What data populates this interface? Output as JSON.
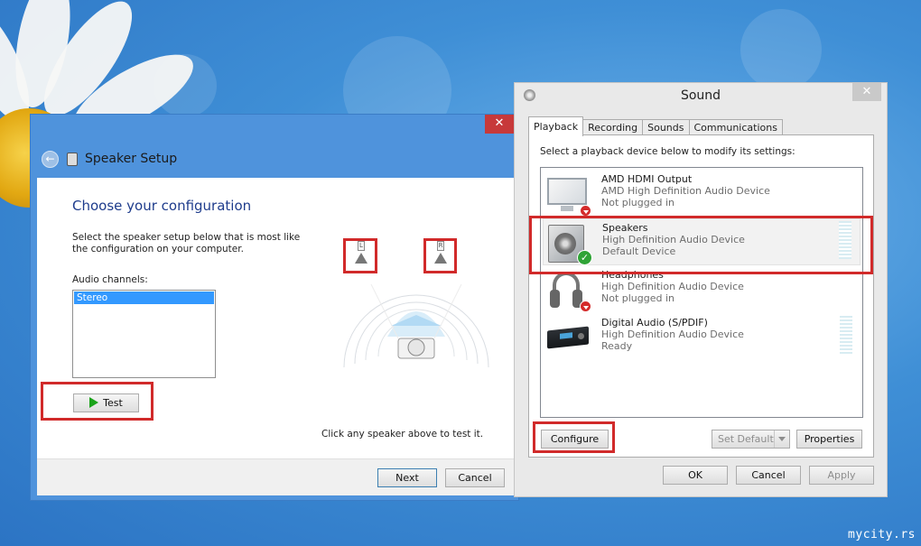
{
  "speaker_setup": {
    "title": "Speaker Setup",
    "heading": "Choose your configuration",
    "description": "Select the speaker setup below that is most like the configuration on your computer.",
    "audio_channels_label": "Audio channels:",
    "channels": [
      "Stereo"
    ],
    "selected_channel": "Stereo",
    "test_label": "Test",
    "speaker_left": "L",
    "speaker_right": "R",
    "click_hint": "Click any speaker above to test it.",
    "next_label": "Next",
    "cancel_label": "Cancel",
    "close_glyph": "✕"
  },
  "sound": {
    "title": "Sound",
    "close_glyph": "✕",
    "tabs": [
      {
        "label": "Playback",
        "active": true
      },
      {
        "label": "Recording",
        "active": false
      },
      {
        "label": "Sounds",
        "active": false
      },
      {
        "label": "Communications",
        "active": false
      }
    ],
    "instruction": "Select a playback device below to modify its settings:",
    "devices": [
      {
        "name": "AMD HDMI Output",
        "driver": "AMD High Definition Audio Device",
        "status": "Not plugged in",
        "icon": "monitor-icon",
        "badge": "unplugged"
      },
      {
        "name": "Speakers",
        "driver": "High Definition Audio Device",
        "status": "Default Device",
        "icon": "speaker-icon",
        "badge": "default"
      },
      {
        "name": "Headphones",
        "driver": "High Definition Audio Device",
        "status": "Not plugged in",
        "icon": "headphones-icon",
        "badge": "unplugged"
      },
      {
        "name": "Digital Audio (S/PDIF)",
        "driver": "High Definition Audio Device",
        "status": "Ready",
        "icon": "receiver-icon",
        "badge": "none"
      }
    ],
    "configure_label": "Configure",
    "set_default_label": "Set Default",
    "properties_label": "Properties",
    "ok_label": "OK",
    "cancel_label": "Cancel",
    "apply_label": "Apply"
  },
  "watermark": "mycity.rs",
  "colors": {
    "highlight_red": "#d12a2a",
    "selection_blue": "#3399ff",
    "heading_blue": "#1e3c8c",
    "close_red": "#c7393a"
  }
}
